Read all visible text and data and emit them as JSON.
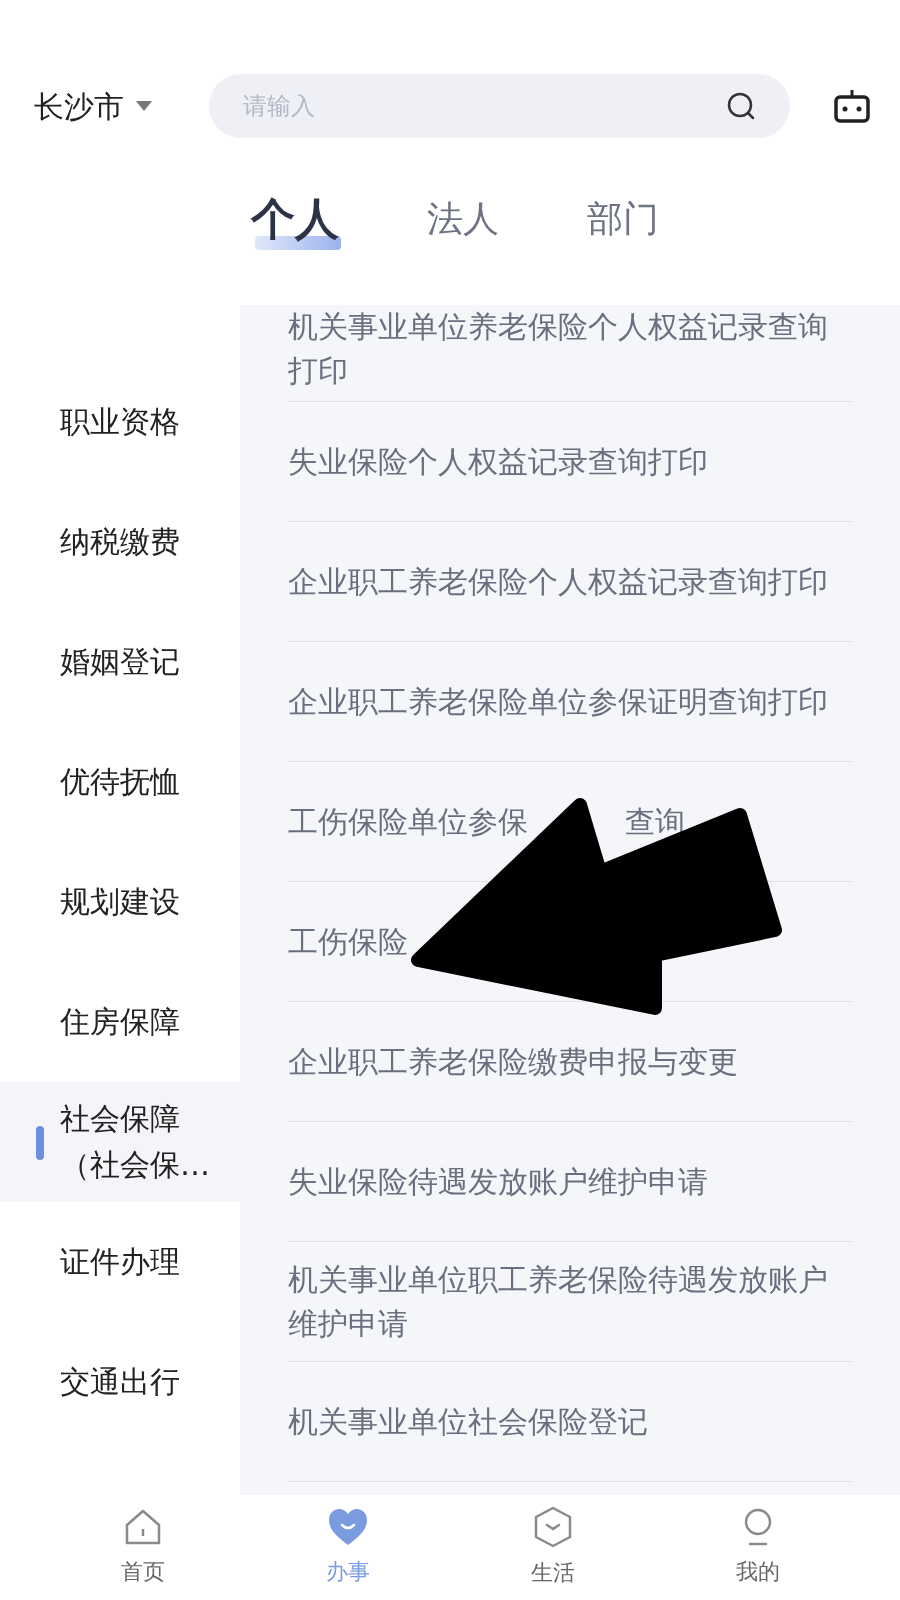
{
  "header": {
    "city": "长沙市",
    "search": {
      "placeholder": "请输入"
    }
  },
  "tabs": [
    {
      "label": "个人",
      "selected": true
    },
    {
      "label": "法人",
      "selected": false
    },
    {
      "label": "部门",
      "selected": false
    }
  ],
  "sidebar": {
    "items": [
      {
        "label": "职业资格",
        "selected": false
      },
      {
        "label": "纳税缴费",
        "selected": false
      },
      {
        "label": "婚姻登记",
        "selected": false
      },
      {
        "label": "优待抚恤",
        "selected": false
      },
      {
        "label": "规划建设",
        "selected": false
      },
      {
        "label": "住房保障",
        "selected": false
      },
      {
        "label": "社会保障（社会保…",
        "selected": true
      },
      {
        "label": "证件办理",
        "selected": false
      },
      {
        "label": "交通出行",
        "selected": false
      }
    ]
  },
  "services": [
    {
      "parts": [
        "机关事业单位养老保险个人权益记录查询打印"
      ]
    },
    {
      "parts": [
        "失业保险个人权益记录查询打印"
      ]
    },
    {
      "parts": [
        "企业职工养老保险个人权益记录查询打印"
      ]
    },
    {
      "parts": [
        "企业职工养老保险单位参保证明查询打印"
      ]
    },
    {
      "parts": [
        "工伤保险单位参保",
        "查询"
      ]
    },
    {
      "parts": [
        "工伤保险"
      ]
    },
    {
      "parts": [
        "企业职工养老保险缴费申报与变更"
      ]
    },
    {
      "parts": [
        "失业保险待遇发放账户维护申请"
      ]
    },
    {
      "parts": [
        "机关事业单位职工养老保险待遇发放账户维护申请"
      ]
    },
    {
      "parts": [
        "机关事业单位社会保险登记"
      ]
    }
  ],
  "bottom_nav": [
    {
      "label": "首页",
      "kind": "home",
      "selected": false
    },
    {
      "label": "办事",
      "kind": "heart",
      "selected": true
    },
    {
      "label": "生活",
      "kind": "hexagon",
      "selected": false
    },
    {
      "label": "我的",
      "kind": "person",
      "selected": false
    }
  ]
}
